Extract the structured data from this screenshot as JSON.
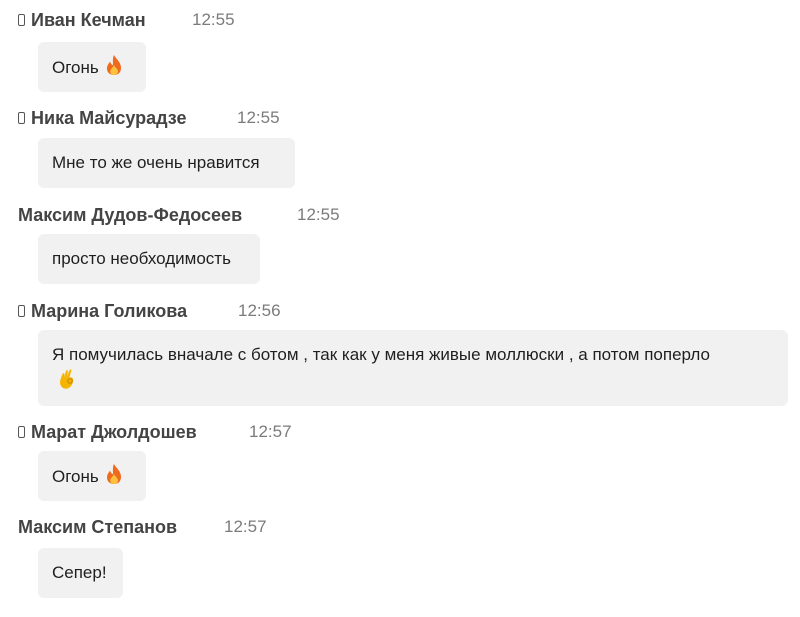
{
  "messages": [
    {
      "author": "Иван Кечман",
      "time": "12:55",
      "text": "Огонь",
      "emoji": "fire-emoji",
      "device_icon": "mobile-phone-icon"
    },
    {
      "author": "Ника Майсурадзе",
      "time": "12:55",
      "text": "Мне то же очень нравится",
      "emoji": null,
      "device_icon": "mobile-phone-icon"
    },
    {
      "author": "Максим Дудов-Федосеев",
      "time": "12:55",
      "text": "просто необходимость",
      "emoji": null,
      "device_icon": null
    },
    {
      "author": "Марина Голикова",
      "time": "12:56",
      "text": "Я помучилась вначале с ботом , так как у меня живые моллюски , а потом поперло",
      "emoji": "ok-hand-emoji",
      "device_icon": "mobile-phone-icon"
    },
    {
      "author": "Марат Джолдошев",
      "time": "12:57",
      "text": "Огонь",
      "emoji": "fire-emoji",
      "device_icon": "mobile-phone-icon"
    },
    {
      "author": "Максим Степанов",
      "time": "12:57",
      "text": "Сепер!",
      "emoji": null,
      "device_icon": null
    }
  ],
  "colors": {
    "bubble_background": "#f1f1f1",
    "author_text": "#444444",
    "time_text": "#7b7b7b",
    "message_text": "#1f1f1f",
    "fire_emoji": "#f06a1d",
    "ok_hand_emoji": "#f4b400"
  }
}
